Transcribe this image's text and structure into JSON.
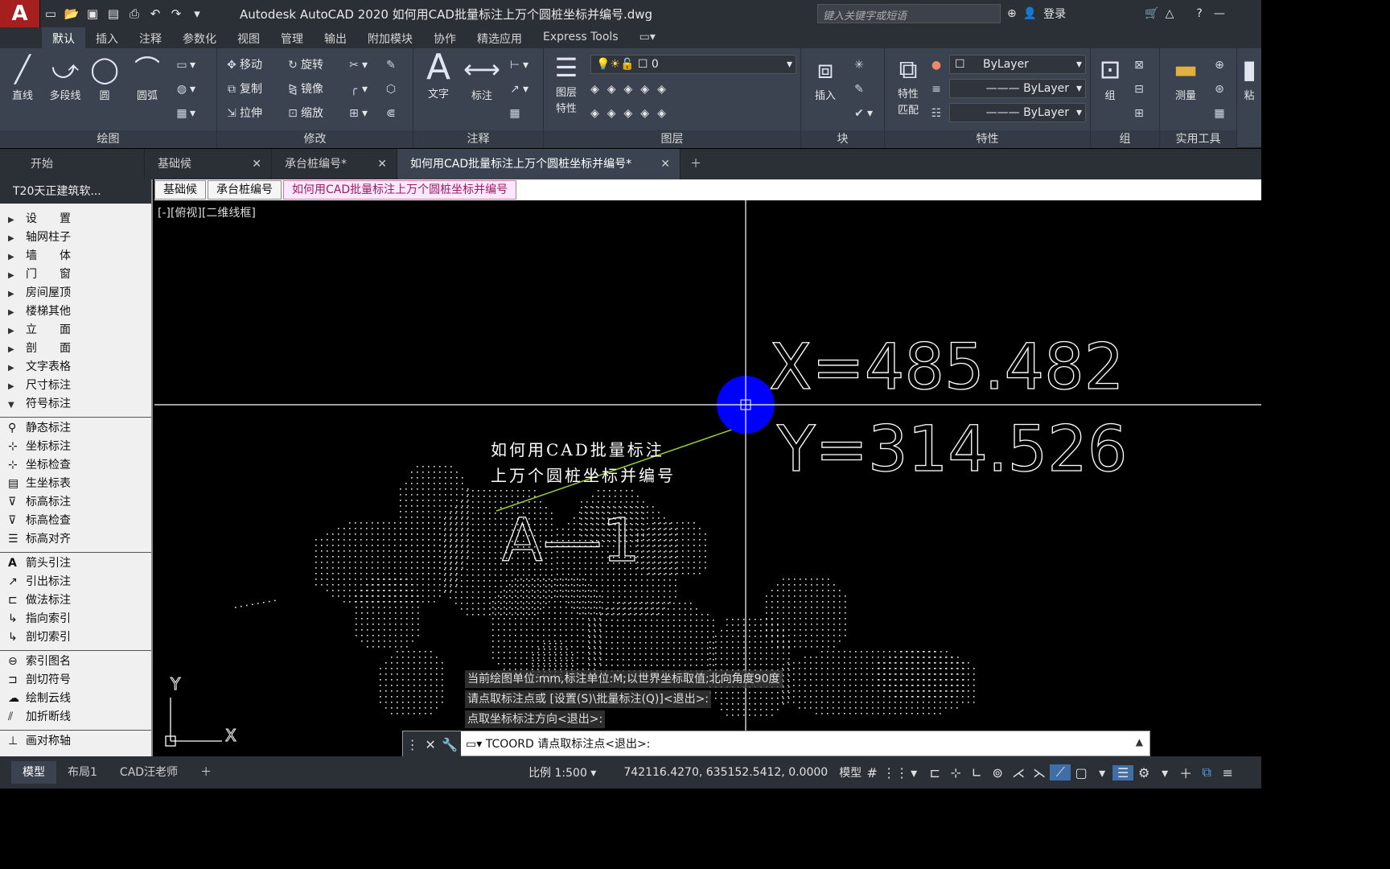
{
  "app": {
    "logo": "A",
    "title": "Autodesk AutoCAD 2020    如何用CAD批量标注上万个圆桩坐标并编号.dwg",
    "search_placeholder": "键入关键字或短语",
    "login": "登录"
  },
  "ribbon_tabs": [
    "默认",
    "插入",
    "注释",
    "参数化",
    "视图",
    "管理",
    "输出",
    "附加模块",
    "协作",
    "精选应用",
    "Express Tools"
  ],
  "ribbon": {
    "draw": {
      "title": "绘图",
      "line": "直线",
      "polyline": "多段线",
      "circle": "圆",
      "arc": "圆弧"
    },
    "modify": {
      "title": "修改",
      "move": "移动",
      "rotate": "旋转",
      "copy": "复制",
      "mirror": "镜像",
      "stretch": "拉伸",
      "scale": "缩放"
    },
    "annotation": {
      "title": "注释",
      "text": "文字",
      "dimension": "标注"
    },
    "layers": {
      "title": "图层",
      "layer_props": "图层\n特性",
      "current_layer": "0"
    },
    "block": {
      "title": "块",
      "insert": "插入"
    },
    "properties": {
      "title": "特性",
      "match": "特性\n匹配",
      "color": "ByLayer",
      "linetype": "ByLayer",
      "lineweight": "ByLayer"
    },
    "groups": {
      "title": "组",
      "group": "组"
    },
    "utilities": {
      "title": "实用工具",
      "measure": "测量"
    },
    "clip": {
      "label": "粘"
    }
  },
  "doc_tabs": [
    {
      "label": "开始",
      "closable": false
    },
    {
      "label": "基础候",
      "closable": true
    },
    {
      "label": "承台桩编号*",
      "closable": true
    },
    {
      "label": "如何用CAD批量标注上万个圆桩坐标并编号*",
      "closable": true
    }
  ],
  "palette": {
    "title": "T20天正建筑软...",
    "groups": [
      "设　　置",
      "轴网柱子",
      "墙　　体",
      "门　　窗",
      "房间屋顶",
      "楼梯其他",
      "立　　面",
      "剖　　面",
      "文字表格",
      "尺寸标注",
      "符号标注"
    ],
    "tools_a": [
      "静态标注",
      "坐标标注",
      "坐标检查",
      "生坐标表",
      "标高标注",
      "标高检查",
      "标高对齐"
    ],
    "tools_b": [
      "箭头引注",
      "引出标注",
      "做法标注",
      "指向索引",
      "剖切索引"
    ],
    "tools_c": [
      "索引图名",
      "剖切符号",
      "绘制云线",
      "加折断线"
    ],
    "tools_d": [
      "画对称轴"
    ]
  },
  "sub_tabs": [
    "基础候",
    "承台桩编号",
    "如何用CAD批量标注上万个圆桩坐标并编号"
  ],
  "viewport_label": "[-][俯视][二维线框]",
  "drawing": {
    "coord_x": "X=485.482",
    "coord_y": "Y=314.526",
    "caption_line1": "如何用CAD批量标注",
    "caption_line2": "上万个圆桩坐标并编号",
    "pile_label": "A—1",
    "ucs_y": "Y",
    "ucs_x": "X"
  },
  "command_history": [
    "当前绘图单位:mm,标注单位:M;以世界坐标取值;北向角度90度",
    "请点取标注点或 [设置(S)\\批量标注(Q)]<退出>:",
    "点取坐标标注方向<退出>:"
  ],
  "command_input": "TCOORD 请点取标注点<退出>:",
  "layout_tabs": [
    "模型",
    "布局1",
    "CAD汪老师"
  ],
  "status": {
    "scale": "比例 1:500",
    "coords": "742116.4270, 635152.5412, 0.0000",
    "space": "模型"
  },
  "colors": {
    "accent_blue": "#0000ff",
    "crosshair": "#ffffff",
    "leader": "#9acd32"
  }
}
